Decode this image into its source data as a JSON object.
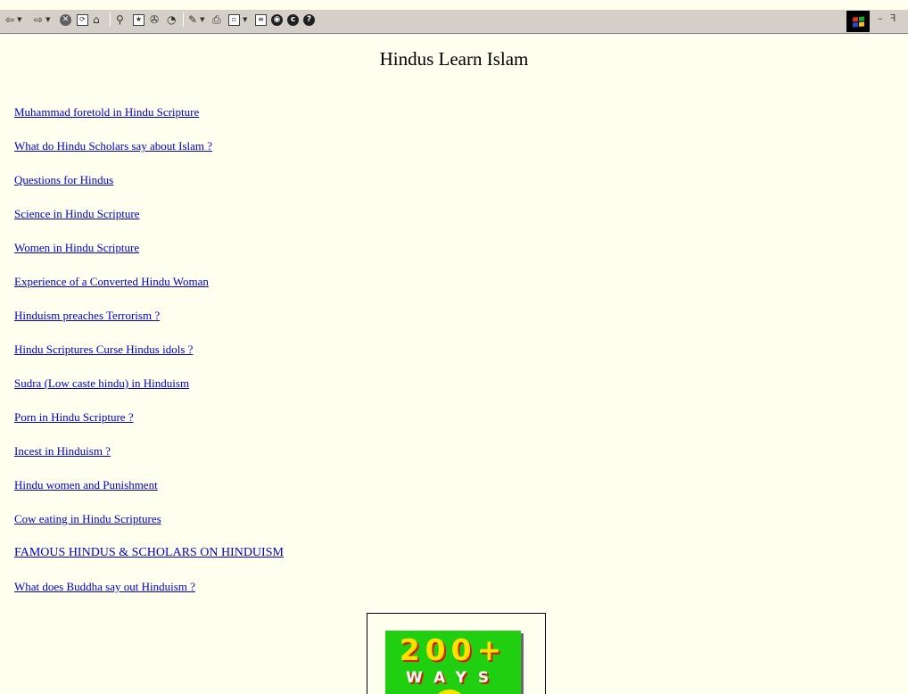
{
  "page": {
    "title": "Hindus Learn Islam",
    "links": [
      "Muhammad foretold in Hindu Scripture",
      "What do Hindu Scholars say about Islam ?",
      "Questions for Hindus",
      "Science in Hindu Scripture",
      "Women in Hindu Scripture",
      "Experience of a Converted Hindu Woman",
      "Hinduism preaches Terrorism ?",
      "Hindu Scriptures Curse Hindus idols ?",
      "Sudra (Low caste hindu) in Hinduism",
      "Porn in Hindu Scripture ?",
      "Incest in Hinduism ?",
      "Hindu women and Punishment",
      "Cow eating in Hindu Scriptures",
      "FAMOUS HINDUS & SCHOLARS ON HINDUISM",
      "What does Buddha say out Hinduism ?"
    ]
  },
  "banner": {
    "line1": "200+",
    "line2": "WAYS"
  },
  "toolbar": {
    "icons": [
      "back-icon",
      "forward-icon",
      "stop-icon",
      "refresh-icon",
      "home-icon",
      "search-icon",
      "favorites-icon",
      "media-icon",
      "history-icon",
      "edit-icon",
      "print-icon",
      "messenger-icon",
      "page-icon",
      "circle-icon",
      "copyright-icon",
      "help-icon"
    ],
    "stop_glyph": "✕",
    "window_minimize": "–",
    "window_restore": "ꟻ"
  },
  "colors": {
    "page_background": "#fffff0",
    "link": "#0000cc",
    "banner_green": "#1fcf10",
    "banner_yellow": "#ffe000",
    "banner_red": "#d02000"
  }
}
